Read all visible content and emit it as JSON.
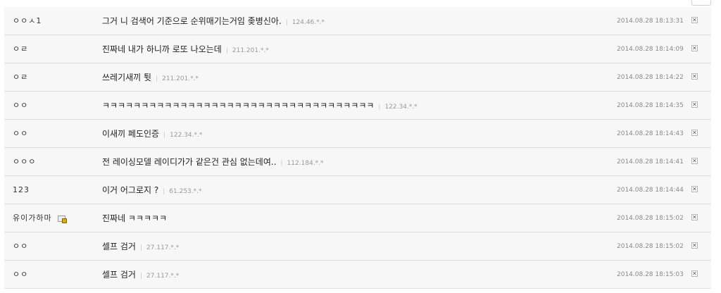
{
  "comments": [
    {
      "nick": "ㅇㅇㅅ1",
      "msg": "그거 니 검색어 기준으로 순위매기는거임 좆병신아.",
      "ip": "124.46.*.*",
      "time": "2014.08.28 18:13:31",
      "icon": false
    },
    {
      "nick": "ㅇㄹ",
      "msg": "진짜네 내가 하니까 로또 나오는데",
      "ip": "211.201.*.*",
      "time": "2014.08.28 18:14:09",
      "icon": false
    },
    {
      "nick": "ㅇㄹ",
      "msg": "쓰레기새끼 튓",
      "ip": "211.201.*.*",
      "time": "2014.08.28 18:14:22",
      "icon": false
    },
    {
      "nick": "ㅇㅇ",
      "msg": "ㅋㅋㅋㅋㅋㅋㅋㅋㅋㅋㅋㅋㅋㅋㅋㅋㅋㅋㅋㅋㅋㅋㅋㅋㅋㅋㅋㅋㅋㅋㅋㅋㅋㅋㅋ",
      "ip": "122.34.*.*",
      "time": "2014.08.28 18:14:35",
      "icon": false
    },
    {
      "nick": "ㅇㅇ",
      "msg": "이새끼 페도인증",
      "ip": "122.34.*.*",
      "time": "2014.08.28 18:14:43",
      "icon": false
    },
    {
      "nick": "ㅇㅇㅇ",
      "msg": "전 레이싱모델 레이디가가 같은건 관심 없는데여..",
      "ip": "112.184.*.*",
      "time": "2014.08.28 18:14:41",
      "icon": false
    },
    {
      "nick": "123",
      "msg": "이거 어그로지 ?",
      "ip": "61.253.*.*",
      "time": "2014.08.28 18:14:44",
      "icon": false
    },
    {
      "nick": "유이가하마",
      "msg": "진짜네 ㅋㅋㅋㅋㅋ",
      "ip": "",
      "time": "2014.08.28 18:15:02",
      "icon": true
    },
    {
      "nick": "ㅇㅇ",
      "msg": "셀프 검거",
      "ip": "27.117.*.*",
      "time": "2014.08.28 18:15:02",
      "icon": false
    },
    {
      "nick": "ㅇㅇ",
      "msg": "셀프 검거",
      "ip": "27.117.*.*",
      "time": "2014.08.28 18:15:03",
      "icon": false
    }
  ],
  "delete_glyph": "✕"
}
